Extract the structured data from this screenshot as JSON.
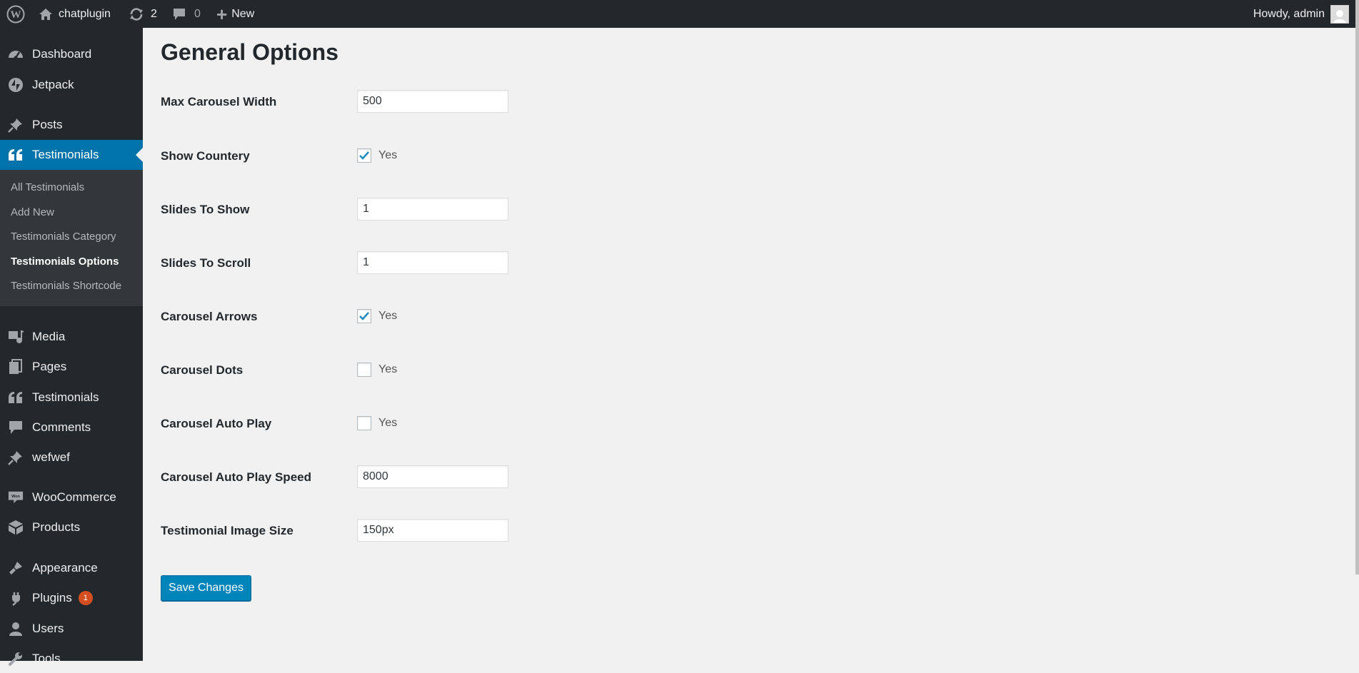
{
  "adminbar": {
    "site_name": "chatplugin",
    "updates_count": "2",
    "comments_count": "0",
    "new_label": "New",
    "howdy": "Howdy, admin"
  },
  "sidebar": {
    "items": [
      {
        "label": "Dashboard",
        "icon": "dashboard-icon"
      },
      {
        "label": "Jetpack",
        "icon": "jetpack-icon"
      },
      {
        "label": "Posts",
        "icon": "pin-icon"
      },
      {
        "label": "Testimonials",
        "icon": "quote-icon"
      },
      {
        "label": "Media",
        "icon": "media-icon"
      },
      {
        "label": "Pages",
        "icon": "pages-icon"
      },
      {
        "label": "Testimonials",
        "icon": "quote-icon"
      },
      {
        "label": "Comments",
        "icon": "comment-icon"
      },
      {
        "label": "wefwef",
        "icon": "pin-icon"
      },
      {
        "label": "WooCommerce",
        "icon": "woocommerce-icon"
      },
      {
        "label": "Products",
        "icon": "box-icon"
      },
      {
        "label": "Appearance",
        "icon": "brush-icon"
      },
      {
        "label": "Plugins",
        "icon": "plug-icon",
        "badge": "1"
      },
      {
        "label": "Users",
        "icon": "user-icon"
      },
      {
        "label": "Tools",
        "icon": "wrench-icon"
      }
    ],
    "submenu": [
      {
        "label": "All Testimonials"
      },
      {
        "label": "Add New"
      },
      {
        "label": "Testimonials Category"
      },
      {
        "label": "Testimonials Options"
      },
      {
        "label": "Testimonials Shortcode"
      }
    ]
  },
  "page": {
    "title": "General Options",
    "save_label": "Save Changes"
  },
  "fields": [
    {
      "label": "Max Carousel Width",
      "value": "500"
    },
    {
      "label": "Show Countery",
      "checkbox_label": "Yes",
      "checked": true
    },
    {
      "label": "Slides To Show",
      "value": "1"
    },
    {
      "label": "Slides To Scroll",
      "value": "1"
    },
    {
      "label": "Carousel Arrows",
      "checkbox_label": "Yes",
      "checked": true
    },
    {
      "label": "Carousel Dots",
      "checkbox_label": "Yes",
      "checked": false
    },
    {
      "label": "Carousel Auto Play",
      "checkbox_label": "Yes",
      "checked": false
    },
    {
      "label": "Carousel Auto Play Speed",
      "value": "8000"
    },
    {
      "label": "Testimonial Image Size",
      "value": "150px"
    }
  ],
  "colors": {
    "adminbar": "#23282d",
    "sidebar": "#23282d",
    "submenu": "#32373c",
    "current": "#0073aa",
    "button": "#0085ba",
    "background": "#f1f1f1"
  }
}
